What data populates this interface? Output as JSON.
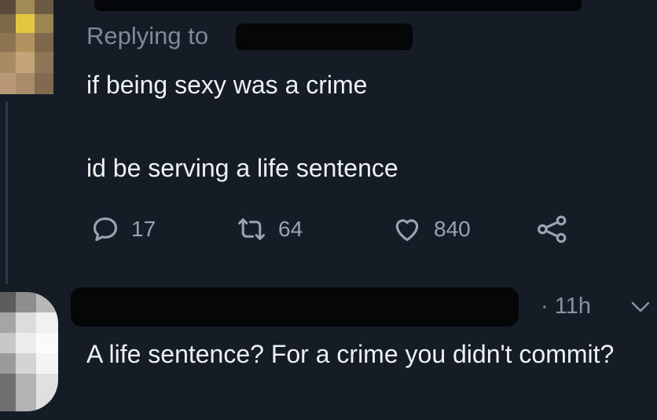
{
  "parent_tweet": {
    "replying_to_label": "Replying to",
    "line_1": "if being sexy was a crime",
    "line_2": "id be serving a life sentence",
    "actions": {
      "reply_count": "17",
      "retweet_count": "64",
      "like_count": "840"
    }
  },
  "reply_tweet": {
    "time": "· 11h",
    "text": "A life sentence? For a crime you didn't commit?"
  },
  "icons": [
    "reply-icon",
    "retweet-icon",
    "heart-icon",
    "share-icon",
    "chevron-down-icon"
  ],
  "colors": {
    "background": "#141c26",
    "text": "#eef0f2",
    "muted": "#8a949e",
    "redaction": "#050608"
  }
}
